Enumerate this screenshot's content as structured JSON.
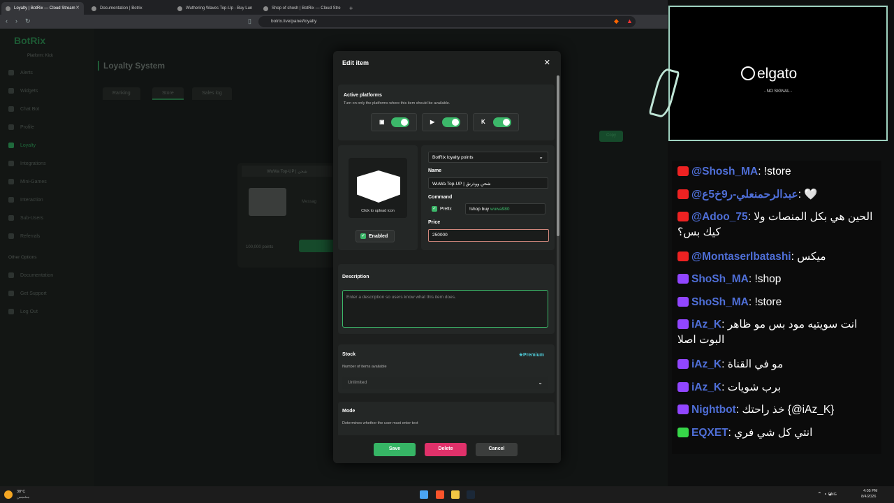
{
  "browser": {
    "tabs": [
      {
        "title": "Loyalty | BotRix — Cloud Stream",
        "active": true
      },
      {
        "title": "Documentation | Botrix",
        "active": false
      },
      {
        "title": "Wuthering Waves Top-Up - Buy Lun",
        "active": false
      },
      {
        "title": "Shop of shosh | BotRix — Cloud Stre",
        "active": false
      }
    ],
    "url": "botrix.live/panel/loyalty"
  },
  "sidebar": {
    "logo": "BotRix",
    "platform_label": "Platform: Kick",
    "items": [
      "Alerts",
      "Widgets",
      "Chat Bot",
      "Profile",
      "Loyalty",
      "Integrations",
      "Mini-Games",
      "Interaction",
      "Sub-Users",
      "Referrals"
    ],
    "other_heading": "Other Options",
    "other_items": [
      "Documentation",
      "Get Support",
      "Log Out"
    ]
  },
  "page": {
    "title": "Loyalty System",
    "tabs": [
      "Ranking",
      "Store",
      "Sales log"
    ],
    "copy_label": "Copy",
    "card_title": "WuWa Top-UP | شحن",
    "card_points": "100,000 points",
    "card_message": "Messag"
  },
  "modal": {
    "title": "Edit item",
    "active_platforms_title": "Active platforms",
    "active_platforms_sub": "Turn on only the platforms where this item should be available.",
    "platforms": [
      {
        "icon": "twitch-icon",
        "on": true
      },
      {
        "icon": "youtube-icon",
        "on": true
      },
      {
        "icon": "kick-icon",
        "on": true
      }
    ],
    "upload_label": "Click to upload icon",
    "enabled_label": "Enabled",
    "currency_select": "BotRix loyalty points",
    "name_label": "Name",
    "name_value": "WuWa Top-UP | شحن ووذرنق",
    "command_label": "Command",
    "prefix_label": "Prefix",
    "command_prefix": "!shop buy ",
    "command_value": "wuwa980",
    "price_label": "Price",
    "price_value": "250000",
    "description_label": "Description",
    "description_placeholder": "Enter a description so users know what this item does.",
    "stock_label": "Stock",
    "stock_sub": "Number of items available",
    "premium_label": "Premium",
    "stock_value": "Unlimited",
    "mode_label": "Mode",
    "mode_sub": "Determines whether the user must enter text",
    "save_label": "Save",
    "delete_label": "Delete",
    "cancel_label": "Cancel",
    "colors": {
      "save": "#36b565",
      "delete": "#e0316a",
      "cancel": "#3b3d3c",
      "accent": "#3cb86a"
    }
  },
  "camera": {
    "brand": "elgato",
    "status": "- NO SIGNAL -"
  },
  "chat": [
    {
      "platform": "youtube",
      "user": "@Shosh_MA",
      "text": "!store"
    },
    {
      "platform": "youtube",
      "user": "@عبدالرحمنعلي-ر9خ5ع",
      "text": "🤍"
    },
    {
      "platform": "youtube",
      "user": "@Adoo_75",
      "text": "الحين هي بكل المنصات ولا كيك بس؟"
    },
    {
      "platform": "youtube",
      "user": "@Montaserlbatashi",
      "text": "ميكس"
    },
    {
      "platform": "twitch",
      "user": "ShoSh_MA",
      "text": "!shop"
    },
    {
      "platform": "twitch",
      "user": "ShoSh_MA",
      "text": "!store"
    },
    {
      "platform": "twitch",
      "user": "iAz_K",
      "text": "انت سويتيه مود بس مو ظاهر البوت اصلا"
    },
    {
      "platform": "twitch",
      "user": "iAz_K",
      "text": "مو في القناة"
    },
    {
      "platform": "twitch",
      "user": "iAz_K",
      "text": "برب شويات"
    },
    {
      "platform": "twitch",
      "user": "Nightbot",
      "text": "خذ راحتك {@iAz_K}"
    },
    {
      "platform": "kick",
      "user": "EQXET",
      "text": "انتي كل شي فري"
    }
  ],
  "taskbar": {
    "weather_temp": "38°C",
    "weather_desc": "مشمس",
    "lang": "ENG",
    "time": "4:05 PM",
    "date": "8/4/2026"
  }
}
